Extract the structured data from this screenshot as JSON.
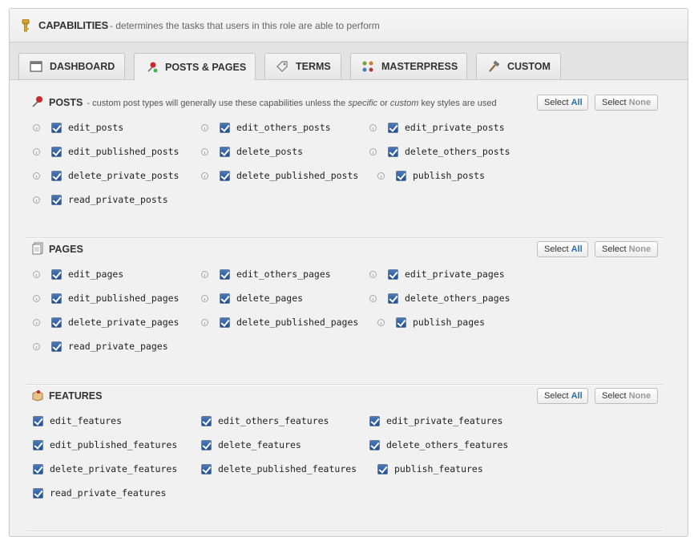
{
  "header": {
    "title": "CAPABILITIES",
    "description": " - determines the tasks that users in this role are able to perform",
    "icon": "key-icon"
  },
  "tabs": [
    {
      "label": "DASHBOARD",
      "icon": "dashboard-icon"
    },
    {
      "label": "POSTS & PAGES",
      "icon": "pushpin-icon",
      "active": true
    },
    {
      "label": "TERMS",
      "icon": "tag-icon"
    },
    {
      "label": "MASTERPRESS",
      "icon": "dots-grid-icon"
    },
    {
      "label": "CUSTOM",
      "icon": "hammer-icon"
    }
  ],
  "buttons": {
    "select_prefix": "Select",
    "all": "All",
    "none": "None"
  },
  "sections": {
    "posts": {
      "title": "POSTS",
      "desc_pre": " - custom post types will generally use these capabilities unless the ",
      "desc_em1": "specific",
      "desc_mid": " or ",
      "desc_em2": "custom",
      "desc_post": " key styles are used",
      "caps": [
        "edit_posts",
        "edit_others_posts",
        "edit_private_posts",
        "edit_published_posts",
        "delete_posts",
        "delete_others_posts",
        "delete_private_posts",
        "delete_published_posts",
        "publish_posts",
        "read_private_posts"
      ]
    },
    "pages": {
      "title": "PAGES",
      "caps": [
        "edit_pages",
        "edit_others_pages",
        "edit_private_pages",
        "edit_published_pages",
        "delete_pages",
        "delete_others_pages",
        "delete_private_pages",
        "delete_published_pages",
        "publish_pages",
        "read_private_pages"
      ]
    },
    "features": {
      "title": "FEATURES",
      "caps": [
        "edit_features",
        "edit_others_features",
        "edit_private_features",
        "edit_published_features",
        "delete_features",
        "delete_others_features",
        "delete_private_features",
        "delete_published_features",
        "publish_features",
        "read_private_features"
      ]
    }
  },
  "colors": {
    "accent_blue": "#2a6fb0",
    "checkbox_blue": "#1f4f94"
  }
}
